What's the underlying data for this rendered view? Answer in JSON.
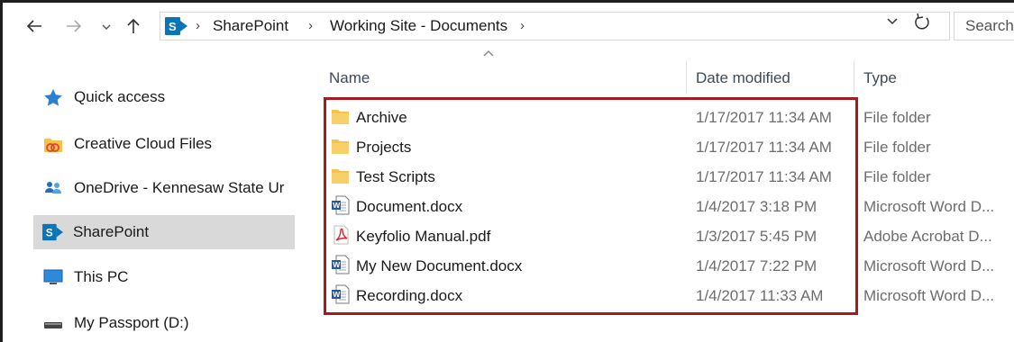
{
  "toolbar": {
    "back_icon": "arrow-left",
    "forward_icon": "arrow-right",
    "recent_icon": "chevron-down",
    "up_icon": "arrow-up"
  },
  "address": {
    "crumbs": [
      "SharePoint",
      "Working Site - Documents"
    ],
    "separator": "›"
  },
  "search": {
    "placeholder": "Search"
  },
  "nav": [
    {
      "label": "Quick access",
      "icon": "star-icon",
      "selected": false
    },
    {
      "label": "Creative Cloud Files",
      "icon": "creative-cloud-folder-icon",
      "selected": false
    },
    {
      "label": "OneDrive - Kennesaw State Ur",
      "icon": "onedrive-icon",
      "selected": false
    },
    {
      "label": "SharePoint",
      "icon": "sharepoint-icon",
      "selected": true
    },
    {
      "label": "This PC",
      "icon": "computer-icon",
      "selected": false
    },
    {
      "label": "My Passport (D:)",
      "icon": "drive-icon",
      "selected": false
    }
  ],
  "columns": {
    "name": "Name",
    "date": "Date modified",
    "type": "Type"
  },
  "files": [
    {
      "name": "Archive",
      "date": "1/17/2017 11:34 AM",
      "type": "File folder",
      "icon": "folder-icon"
    },
    {
      "name": "Projects",
      "date": "1/17/2017 11:34 AM",
      "type": "File folder",
      "icon": "folder-icon"
    },
    {
      "name": "Test Scripts",
      "date": "1/17/2017 11:34 AM",
      "type": "File folder",
      "icon": "folder-icon"
    },
    {
      "name": "Document.docx",
      "date": "1/4/2017 3:18 PM",
      "type": "Microsoft Word D...",
      "icon": "word-doc-icon"
    },
    {
      "name": "Keyfolio Manual.pdf",
      "date": "1/3/2017 5:45 PM",
      "type": "Adobe Acrobat D...",
      "icon": "pdf-icon"
    },
    {
      "name": "My New Document.docx",
      "date": "1/4/2017 7:22 PM",
      "type": "Microsoft Word D...",
      "icon": "word-doc-icon"
    },
    {
      "name": "Recording.docx",
      "date": "1/4/2017 11:33 AM",
      "type": "Microsoft Word D...",
      "icon": "word-doc-icon"
    }
  ],
  "colors": {
    "highlight_border": "#a8191e",
    "selected_nav": "#d9d9d9",
    "folder": "#f5c24a",
    "sharepoint": "#0a74b8",
    "word": "#2b579a",
    "pdf": "#d8262b"
  }
}
